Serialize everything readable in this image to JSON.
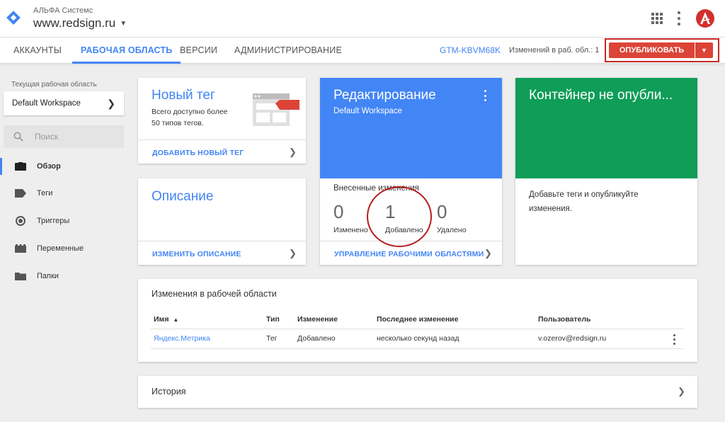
{
  "header": {
    "account": "АЛЬФА Системс",
    "container": "www.redsign.ru"
  },
  "tabs": [
    {
      "label": "АККАУНТЫ"
    },
    {
      "label": "РАБОЧАЯ ОБЛАСТЬ"
    },
    {
      "label": "ВЕРСИИ"
    },
    {
      "label": "АДМИНИСТРИРОВАНИЕ"
    }
  ],
  "navbar": {
    "container_id": "GTM-KBVM68K",
    "changes": "Изменений в раб. обл.: 1",
    "publish": "ОПУБЛИКОВАТЬ"
  },
  "sidebar": {
    "workspace_label": "Текущая рабочая область",
    "workspace": "Default Workspace",
    "search_placeholder": "Поиск",
    "items": [
      {
        "label": "Обзор",
        "icon": "briefcase-icon"
      },
      {
        "label": "Теги",
        "icon": "tag-icon"
      },
      {
        "label": "Триггеры",
        "icon": "trigger-icon"
      },
      {
        "label": "Переменные",
        "icon": "variables-icon"
      },
      {
        "label": "Папки",
        "icon": "folder-icon"
      }
    ]
  },
  "cards": {
    "new_tag": {
      "title": "Новый тег",
      "text1": "Всего доступно более",
      "text2": "50 типов тегов.",
      "link": "ДОБАВИТЬ НОВЫЙ ТЕГ"
    },
    "description": {
      "title": "Описание",
      "link": "ИЗМЕНИТЬ ОПИСАНИЕ"
    },
    "editing": {
      "title": "Редактирование",
      "subtitle": "Default Workspace",
      "changes_label": "Внесенные изменения",
      "modified": {
        "value": "0",
        "label": "Изменено"
      },
      "added": {
        "value": "1",
        "label": "Добавлено"
      },
      "deleted": {
        "value": "0",
        "label": "Удалено"
      },
      "link": "УПРАВЛЕНИЕ РАБОЧИМИ ОБЛАСТЯМИ"
    },
    "container": {
      "title": "Контейнер не опубли...",
      "text1": "Добавьте теги и опубликуйте",
      "text2": "изменения."
    }
  },
  "changes_table": {
    "title": "Изменения в рабочей области",
    "headers": {
      "name": "Имя",
      "type": "Тип",
      "change": "Изменение",
      "last": "Последнее изменение",
      "user": "Пользователь"
    },
    "rows": [
      {
        "name": "Яндекс.Метрика",
        "type": "Тег",
        "change": "Добавлено",
        "last": "несколько секунд назад",
        "user": "v.ozerov@redsign.ru"
      }
    ]
  },
  "history": {
    "title": "История"
  },
  "colors": {
    "accent": "#4285f4",
    "publish": "#db4437",
    "green": "#0f9d58",
    "highlight": "#b71c1c"
  }
}
